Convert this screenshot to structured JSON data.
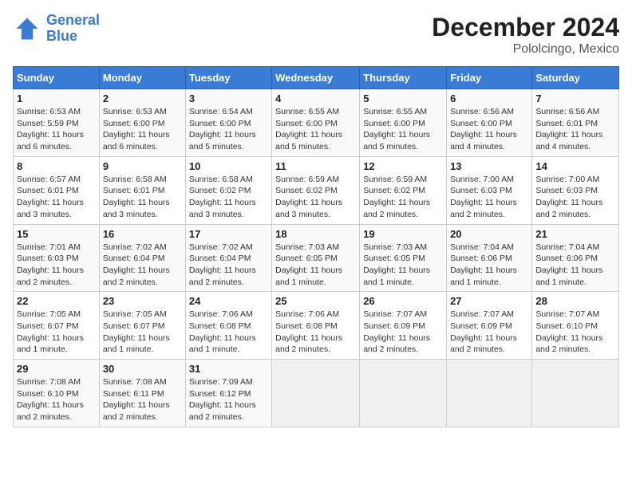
{
  "header": {
    "logo_line1": "General",
    "logo_line2": "Blue",
    "title": "December 2024",
    "subtitle": "Pololcingo, Mexico"
  },
  "calendar": {
    "days_of_week": [
      "Sunday",
      "Monday",
      "Tuesday",
      "Wednesday",
      "Thursday",
      "Friday",
      "Saturday"
    ],
    "weeks": [
      [
        {
          "day": "",
          "info": ""
        },
        {
          "day": "",
          "info": ""
        },
        {
          "day": "",
          "info": ""
        },
        {
          "day": "",
          "info": ""
        },
        {
          "day": "5",
          "info": "Sunrise: 6:55 AM\nSunset: 6:00 PM\nDaylight: 11 hours and 5 minutes."
        },
        {
          "day": "6",
          "info": "Sunrise: 6:56 AM\nSunset: 6:00 PM\nDaylight: 11 hours and 4 minutes."
        },
        {
          "day": "7",
          "info": "Sunrise: 6:56 AM\nSunset: 6:01 PM\nDaylight: 11 hours and 4 minutes."
        }
      ],
      [
        {
          "day": "1",
          "info": "Sunrise: 6:53 AM\nSunset: 5:59 PM\nDaylight: 11 hours and 6 minutes."
        },
        {
          "day": "2",
          "info": "Sunrise: 6:53 AM\nSunset: 6:00 PM\nDaylight: 11 hours and 6 minutes."
        },
        {
          "day": "3",
          "info": "Sunrise: 6:54 AM\nSunset: 6:00 PM\nDaylight: 11 hours and 5 minutes."
        },
        {
          "day": "4",
          "info": "Sunrise: 6:55 AM\nSunset: 6:00 PM\nDaylight: 11 hours and 5 minutes."
        },
        {
          "day": "5",
          "info": "Sunrise: 6:55 AM\nSunset: 6:00 PM\nDaylight: 11 hours and 5 minutes."
        },
        {
          "day": "6",
          "info": "Sunrise: 6:56 AM\nSunset: 6:00 PM\nDaylight: 11 hours and 4 minutes."
        },
        {
          "day": "7",
          "info": "Sunrise: 6:56 AM\nSunset: 6:01 PM\nDaylight: 11 hours and 4 minutes."
        }
      ],
      [
        {
          "day": "8",
          "info": "Sunrise: 6:57 AM\nSunset: 6:01 PM\nDaylight: 11 hours and 3 minutes."
        },
        {
          "day": "9",
          "info": "Sunrise: 6:58 AM\nSunset: 6:01 PM\nDaylight: 11 hours and 3 minutes."
        },
        {
          "day": "10",
          "info": "Sunrise: 6:58 AM\nSunset: 6:02 PM\nDaylight: 11 hours and 3 minutes."
        },
        {
          "day": "11",
          "info": "Sunrise: 6:59 AM\nSunset: 6:02 PM\nDaylight: 11 hours and 3 minutes."
        },
        {
          "day": "12",
          "info": "Sunrise: 6:59 AM\nSunset: 6:02 PM\nDaylight: 11 hours and 2 minutes."
        },
        {
          "day": "13",
          "info": "Sunrise: 7:00 AM\nSunset: 6:03 PM\nDaylight: 11 hours and 2 minutes."
        },
        {
          "day": "14",
          "info": "Sunrise: 7:00 AM\nSunset: 6:03 PM\nDaylight: 11 hours and 2 minutes."
        }
      ],
      [
        {
          "day": "15",
          "info": "Sunrise: 7:01 AM\nSunset: 6:03 PM\nDaylight: 11 hours and 2 minutes."
        },
        {
          "day": "16",
          "info": "Sunrise: 7:02 AM\nSunset: 6:04 PM\nDaylight: 11 hours and 2 minutes."
        },
        {
          "day": "17",
          "info": "Sunrise: 7:02 AM\nSunset: 6:04 PM\nDaylight: 11 hours and 2 minutes."
        },
        {
          "day": "18",
          "info": "Sunrise: 7:03 AM\nSunset: 6:05 PM\nDaylight: 11 hours and 1 minute."
        },
        {
          "day": "19",
          "info": "Sunrise: 7:03 AM\nSunset: 6:05 PM\nDaylight: 11 hours and 1 minute."
        },
        {
          "day": "20",
          "info": "Sunrise: 7:04 AM\nSunset: 6:06 PM\nDaylight: 11 hours and 1 minute."
        },
        {
          "day": "21",
          "info": "Sunrise: 7:04 AM\nSunset: 6:06 PM\nDaylight: 11 hours and 1 minute."
        }
      ],
      [
        {
          "day": "22",
          "info": "Sunrise: 7:05 AM\nSunset: 6:07 PM\nDaylight: 11 hours and 1 minute."
        },
        {
          "day": "23",
          "info": "Sunrise: 7:05 AM\nSunset: 6:07 PM\nDaylight: 11 hours and 1 minute."
        },
        {
          "day": "24",
          "info": "Sunrise: 7:06 AM\nSunset: 6:08 PM\nDaylight: 11 hours and 1 minute."
        },
        {
          "day": "25",
          "info": "Sunrise: 7:06 AM\nSunset: 6:08 PM\nDaylight: 11 hours and 2 minutes."
        },
        {
          "day": "26",
          "info": "Sunrise: 7:07 AM\nSunset: 6:09 PM\nDaylight: 11 hours and 2 minutes."
        },
        {
          "day": "27",
          "info": "Sunrise: 7:07 AM\nSunset: 6:09 PM\nDaylight: 11 hours and 2 minutes."
        },
        {
          "day": "28",
          "info": "Sunrise: 7:07 AM\nSunset: 6:10 PM\nDaylight: 11 hours and 2 minutes."
        }
      ],
      [
        {
          "day": "29",
          "info": "Sunrise: 7:08 AM\nSunset: 6:10 PM\nDaylight: 11 hours and 2 minutes."
        },
        {
          "day": "30",
          "info": "Sunrise: 7:08 AM\nSunset: 6:11 PM\nDaylight: 11 hours and 2 minutes."
        },
        {
          "day": "31",
          "info": "Sunrise: 7:09 AM\nSunset: 6:12 PM\nDaylight: 11 hours and 2 minutes."
        },
        {
          "day": "",
          "info": ""
        },
        {
          "day": "",
          "info": ""
        },
        {
          "day": "",
          "info": ""
        },
        {
          "day": "",
          "info": ""
        }
      ]
    ]
  }
}
